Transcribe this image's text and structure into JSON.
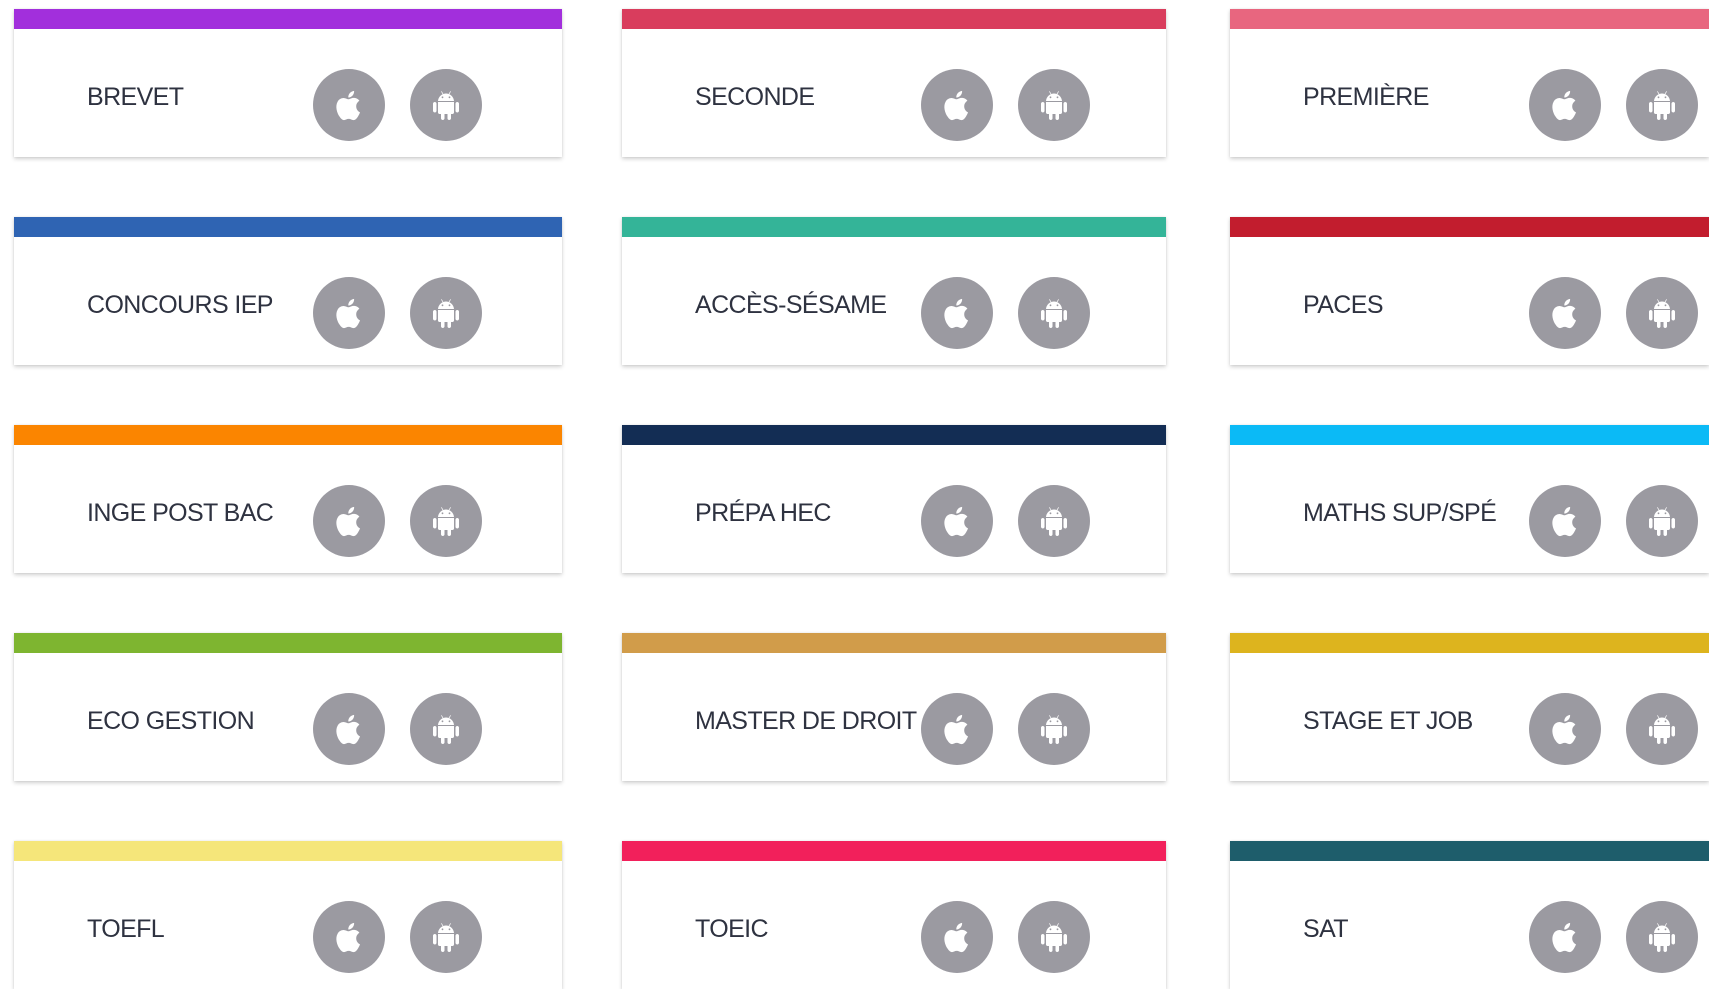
{
  "cards": [
    {
      "label": "BREVET",
      "color": "#a22fdc"
    },
    {
      "label": "SECONDE",
      "color": "#d93d5d"
    },
    {
      "label": "PREMIÈRE",
      "color": "#e8667f"
    },
    {
      "label": "CONCOURS IEP",
      "color": "#2f64b3"
    },
    {
      "label": "ACCÈS-SÉSAME",
      "color": "#34b498"
    },
    {
      "label": "PACES",
      "color": "#c21d2e"
    },
    {
      "label": "INGE POST BAC",
      "color": "#fb8500"
    },
    {
      "label": "PRÉPA HEC",
      "color": "#132d54"
    },
    {
      "label": "MATHS SUP/SPÉ",
      "color": "#0bbaf6"
    },
    {
      "label": "ECO GESTION",
      "color": "#7eb530"
    },
    {
      "label": "MASTER DE DROIT",
      "color": "#d19c4a"
    },
    {
      "label": "STAGE ET JOB",
      "color": "#ddb41e"
    },
    {
      "label": "TOEFL",
      "color": "#f5e67a"
    },
    {
      "label": "TOEIC",
      "color": "#f2205b"
    },
    {
      "label": "SAT",
      "color": "#1e5d6b"
    }
  ],
  "icons": {
    "ios": "apple-icon",
    "android": "android-icon"
  },
  "icon_button_color": "#9b9aa1"
}
